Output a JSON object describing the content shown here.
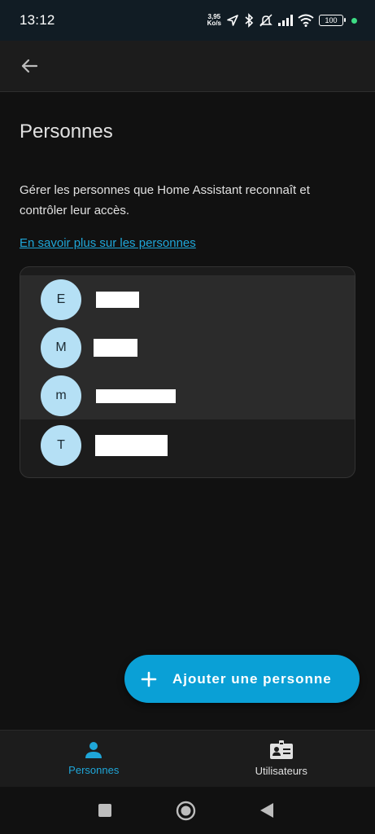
{
  "status_bar": {
    "time": "13:12",
    "net_speed_value": "3,95",
    "net_speed_unit": "Ko/s",
    "battery": "100"
  },
  "page": {
    "title": "Personnes",
    "description": "Gérer les personnes que Home Assistant reconnaît et contrôler leur accès.",
    "learn_more_link": "En savoir plus sur les personnes"
  },
  "people": [
    {
      "initial": "E"
    },
    {
      "initial": "M"
    },
    {
      "initial": "m"
    },
    {
      "initial": "T"
    }
  ],
  "fab": {
    "label": "Ajouter une personne"
  },
  "bottom_nav": {
    "items": [
      {
        "label": "Personnes",
        "active": true
      },
      {
        "label": "Utilisateurs",
        "active": false
      }
    ]
  },
  "colors": {
    "accent": "#1fa6d8",
    "fab": "#0aa0d6",
    "avatar_bg": "#b5e0f5",
    "background": "#111111",
    "surface": "#1c1c1c"
  },
  "icons": {
    "back": "arrow-left-icon",
    "fab": "plus-icon",
    "nav_people": "account-icon",
    "nav_users": "badge-account-icon"
  }
}
